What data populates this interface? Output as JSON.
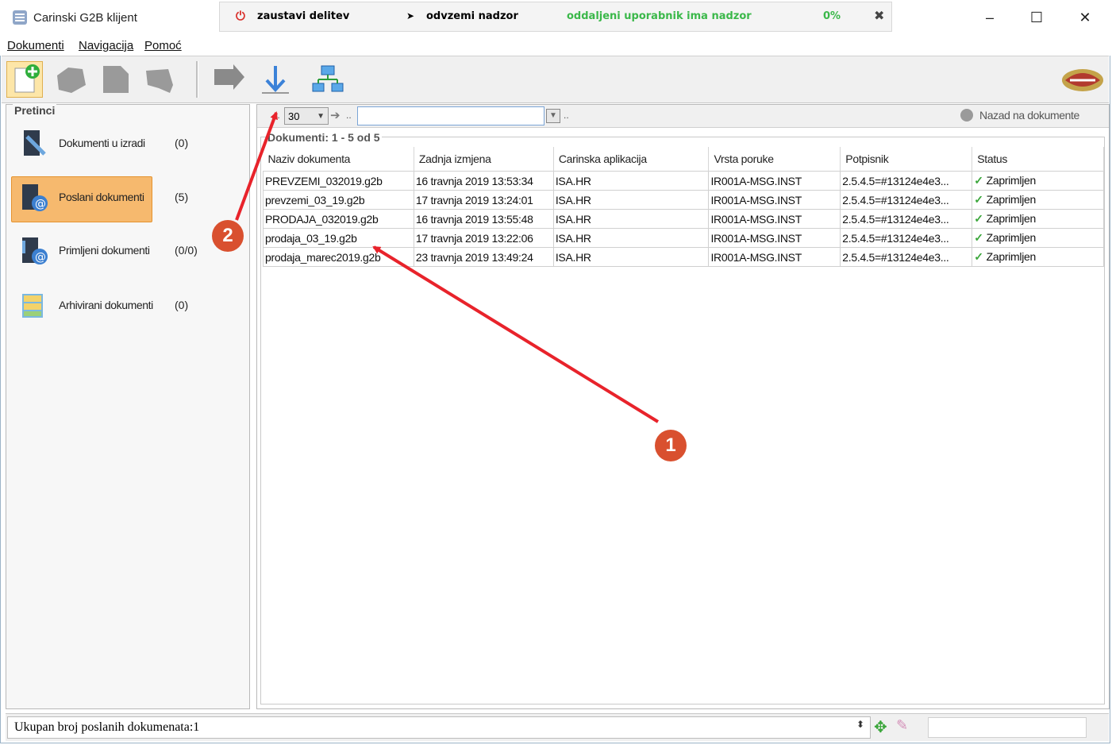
{
  "window": {
    "title": "Carinski G2B klijent",
    "controls": [
      "–",
      "☐",
      "✕"
    ]
  },
  "remote_bar": {
    "stop_label": "zaustavi delitev",
    "revoke_label": "odvzemi nadzor",
    "status_label": "oddaljeni uporabnik ima nadzor",
    "percent": "0%"
  },
  "menu": {
    "items": [
      "Dokumenti",
      "Navigacija",
      "Pomoć"
    ]
  },
  "sidebar": {
    "legend": "Pretinci",
    "folders": [
      {
        "label": "Dokumenti u izradi",
        "count": "(0)"
      },
      {
        "label": "Poslani dokumenti",
        "count": "(5)"
      },
      {
        "label": "Primljeni dokumenti",
        "count": "(0/0)"
      },
      {
        "label": "Arhivirani dokumenti",
        "count": "(0)"
      }
    ]
  },
  "nav": {
    "page_size": "30",
    "dots1": "..",
    "dots2": "..",
    "dots3": "..",
    "search_value": "",
    "back_label": "Nazad na dokumente"
  },
  "documents": {
    "legend": "Dokumenti: 1 - 5 od 5",
    "columns": [
      "Naziv dokumenta",
      "Zadnja izmjena",
      "Carinska aplikacija",
      "Vrsta poruke",
      "Potpisnik",
      "Status"
    ],
    "rows": [
      [
        "PREVZEMI_032019.g2b",
        "16 travnja 2019 13:53:34",
        "ISA.HR",
        "IR001A-MSG.INST",
        "2.5.4.5=#13124e4e3...",
        "Zaprimljen"
      ],
      [
        "prevzemi_03_19.g2b",
        "17 travnja 2019 13:24:01",
        "ISA.HR",
        "IR001A-MSG.INST",
        "2.5.4.5=#13124e4e3...",
        "Zaprimljen"
      ],
      [
        "PRODAJA_032019.g2b",
        "16 travnja 2019 13:55:48",
        "ISA.HR",
        "IR001A-MSG.INST",
        "2.5.4.5=#13124e4e3...",
        "Zaprimljen"
      ],
      [
        "prodaja_03_19.g2b",
        "17 travnja 2019 13:22:06",
        "ISA.HR",
        "IR001A-MSG.INST",
        "2.5.4.5=#13124e4e3...",
        "Zaprimljen"
      ],
      [
        "prodaja_marec2019.g2b",
        "23 travnja 2019 13:49:24",
        "ISA.HR",
        "IR001A-MSG.INST",
        "2.5.4.5=#13124e4e3...",
        "Zaprimljen"
      ]
    ]
  },
  "statusbar": {
    "text": "Ukupan broj poslanih dokumenata:1"
  },
  "annotations": {
    "one": "1",
    "two": "2"
  },
  "colors": {
    "selection": "#f6b96e",
    "annotation": "#d9502f",
    "arrow": "#e8232b",
    "ok_green": "#3aa63a",
    "remote_green": "#3bb84a"
  }
}
